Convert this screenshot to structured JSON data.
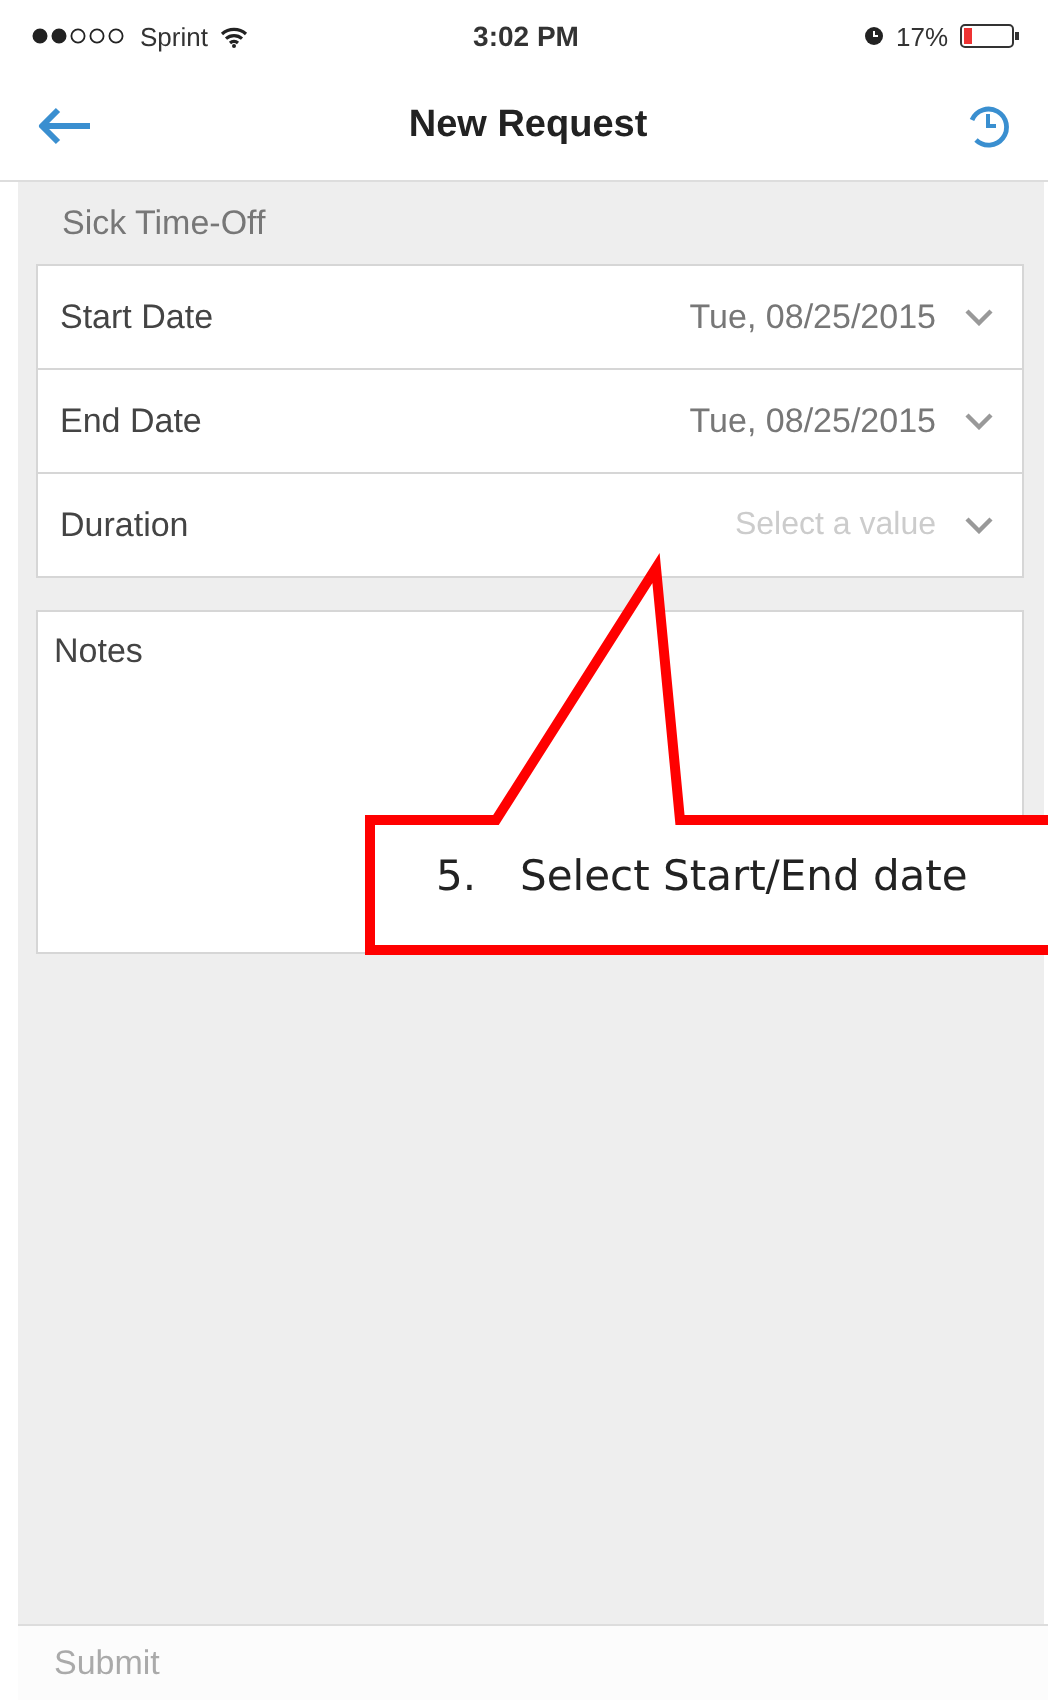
{
  "status_bar": {
    "carrier": "Sprint",
    "time": "3:02 PM",
    "battery": "17%"
  },
  "nav": {
    "title": "New Request"
  },
  "section": {
    "title": "Sick Time-Off"
  },
  "fields": [
    {
      "label": "Start Date",
      "value": "Tue, 08/25/2015"
    },
    {
      "label": "End Date",
      "value": "Tue, 08/25/2015"
    },
    {
      "label": "Duration",
      "placeholder": "Select a value"
    }
  ],
  "notes": {
    "label": "Notes"
  },
  "submit": {
    "label": "Submit",
    "disabled": true
  },
  "callout": {
    "number": "5.",
    "text": "Select Start/End date"
  }
}
